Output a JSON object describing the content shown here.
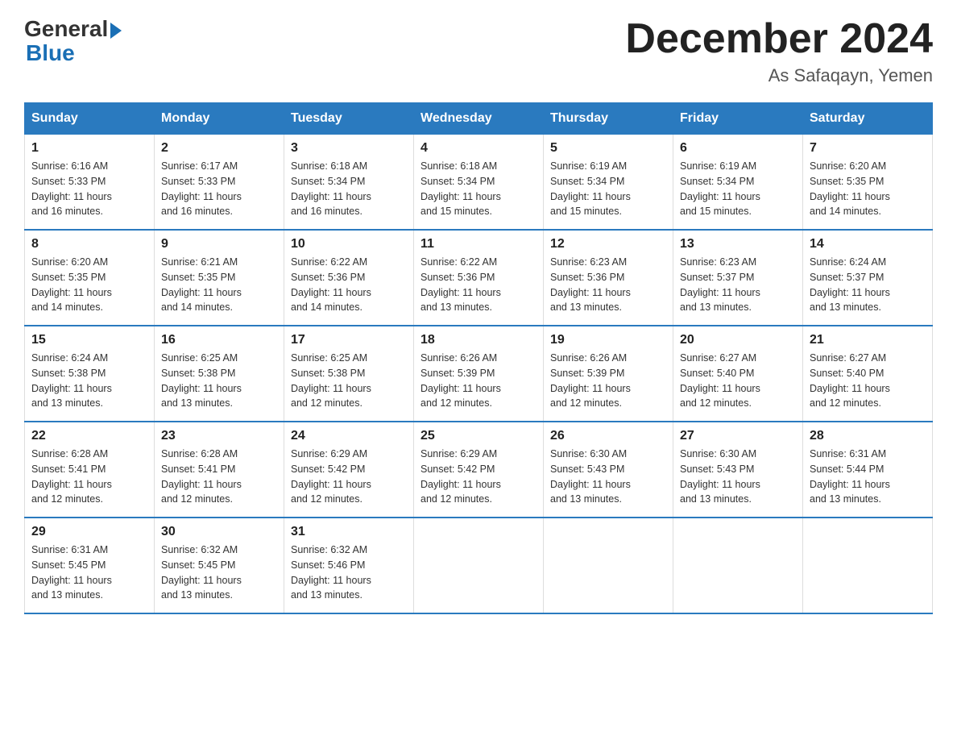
{
  "header": {
    "logo_general": "General",
    "logo_blue": "Blue",
    "month_title": "December 2024",
    "location": "As Safaqayn, Yemen"
  },
  "days_of_week": [
    "Sunday",
    "Monday",
    "Tuesday",
    "Wednesday",
    "Thursday",
    "Friday",
    "Saturday"
  ],
  "weeks": [
    [
      {
        "day": "1",
        "sunrise": "6:16 AM",
        "sunset": "5:33 PM",
        "daylight": "11 hours and 16 minutes."
      },
      {
        "day": "2",
        "sunrise": "6:17 AM",
        "sunset": "5:33 PM",
        "daylight": "11 hours and 16 minutes."
      },
      {
        "day": "3",
        "sunrise": "6:18 AM",
        "sunset": "5:34 PM",
        "daylight": "11 hours and 16 minutes."
      },
      {
        "day": "4",
        "sunrise": "6:18 AM",
        "sunset": "5:34 PM",
        "daylight": "11 hours and 15 minutes."
      },
      {
        "day": "5",
        "sunrise": "6:19 AM",
        "sunset": "5:34 PM",
        "daylight": "11 hours and 15 minutes."
      },
      {
        "day": "6",
        "sunrise": "6:19 AM",
        "sunset": "5:34 PM",
        "daylight": "11 hours and 15 minutes."
      },
      {
        "day": "7",
        "sunrise": "6:20 AM",
        "sunset": "5:35 PM",
        "daylight": "11 hours and 14 minutes."
      }
    ],
    [
      {
        "day": "8",
        "sunrise": "6:20 AM",
        "sunset": "5:35 PM",
        "daylight": "11 hours and 14 minutes."
      },
      {
        "day": "9",
        "sunrise": "6:21 AM",
        "sunset": "5:35 PM",
        "daylight": "11 hours and 14 minutes."
      },
      {
        "day": "10",
        "sunrise": "6:22 AM",
        "sunset": "5:36 PM",
        "daylight": "11 hours and 14 minutes."
      },
      {
        "day": "11",
        "sunrise": "6:22 AM",
        "sunset": "5:36 PM",
        "daylight": "11 hours and 13 minutes."
      },
      {
        "day": "12",
        "sunrise": "6:23 AM",
        "sunset": "5:36 PM",
        "daylight": "11 hours and 13 minutes."
      },
      {
        "day": "13",
        "sunrise": "6:23 AM",
        "sunset": "5:37 PM",
        "daylight": "11 hours and 13 minutes."
      },
      {
        "day": "14",
        "sunrise": "6:24 AM",
        "sunset": "5:37 PM",
        "daylight": "11 hours and 13 minutes."
      }
    ],
    [
      {
        "day": "15",
        "sunrise": "6:24 AM",
        "sunset": "5:38 PM",
        "daylight": "11 hours and 13 minutes."
      },
      {
        "day": "16",
        "sunrise": "6:25 AM",
        "sunset": "5:38 PM",
        "daylight": "11 hours and 13 minutes."
      },
      {
        "day": "17",
        "sunrise": "6:25 AM",
        "sunset": "5:38 PM",
        "daylight": "11 hours and 12 minutes."
      },
      {
        "day": "18",
        "sunrise": "6:26 AM",
        "sunset": "5:39 PM",
        "daylight": "11 hours and 12 minutes."
      },
      {
        "day": "19",
        "sunrise": "6:26 AM",
        "sunset": "5:39 PM",
        "daylight": "11 hours and 12 minutes."
      },
      {
        "day": "20",
        "sunrise": "6:27 AM",
        "sunset": "5:40 PM",
        "daylight": "11 hours and 12 minutes."
      },
      {
        "day": "21",
        "sunrise": "6:27 AM",
        "sunset": "5:40 PM",
        "daylight": "11 hours and 12 minutes."
      }
    ],
    [
      {
        "day": "22",
        "sunrise": "6:28 AM",
        "sunset": "5:41 PM",
        "daylight": "11 hours and 12 minutes."
      },
      {
        "day": "23",
        "sunrise": "6:28 AM",
        "sunset": "5:41 PM",
        "daylight": "11 hours and 12 minutes."
      },
      {
        "day": "24",
        "sunrise": "6:29 AM",
        "sunset": "5:42 PM",
        "daylight": "11 hours and 12 minutes."
      },
      {
        "day": "25",
        "sunrise": "6:29 AM",
        "sunset": "5:42 PM",
        "daylight": "11 hours and 12 minutes."
      },
      {
        "day": "26",
        "sunrise": "6:30 AM",
        "sunset": "5:43 PM",
        "daylight": "11 hours and 13 minutes."
      },
      {
        "day": "27",
        "sunrise": "6:30 AM",
        "sunset": "5:43 PM",
        "daylight": "11 hours and 13 minutes."
      },
      {
        "day": "28",
        "sunrise": "6:31 AM",
        "sunset": "5:44 PM",
        "daylight": "11 hours and 13 minutes."
      }
    ],
    [
      {
        "day": "29",
        "sunrise": "6:31 AM",
        "sunset": "5:45 PM",
        "daylight": "11 hours and 13 minutes."
      },
      {
        "day": "30",
        "sunrise": "6:32 AM",
        "sunset": "5:45 PM",
        "daylight": "11 hours and 13 minutes."
      },
      {
        "day": "31",
        "sunrise": "6:32 AM",
        "sunset": "5:46 PM",
        "daylight": "11 hours and 13 minutes."
      },
      null,
      null,
      null,
      null
    ]
  ]
}
